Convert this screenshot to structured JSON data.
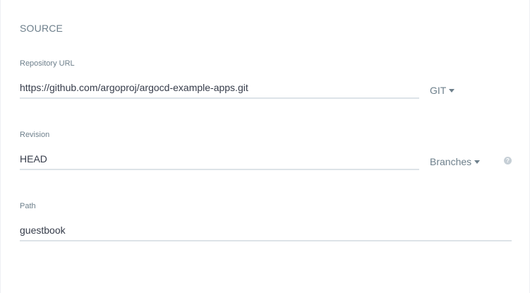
{
  "section": {
    "title": "SOURCE"
  },
  "repository": {
    "label": "Repository URL",
    "value": "https://github.com/argoproj/argocd-example-apps.git",
    "type_dropdown": {
      "selected": "GIT",
      "icon": "caret-down-icon"
    }
  },
  "revision": {
    "label": "Revision",
    "value": "HEAD",
    "ref_dropdown": {
      "selected": "Branches",
      "icon": "caret-down-icon"
    },
    "help": {
      "glyph": "?",
      "icon": "question-circle-icon"
    }
  },
  "path": {
    "label": "Path",
    "value": "guestbook"
  },
  "colors": {
    "label": "#6d7f8b",
    "text": "#363c4a",
    "underline": "#dde3e8",
    "help_bg": "#c6cfd6"
  }
}
